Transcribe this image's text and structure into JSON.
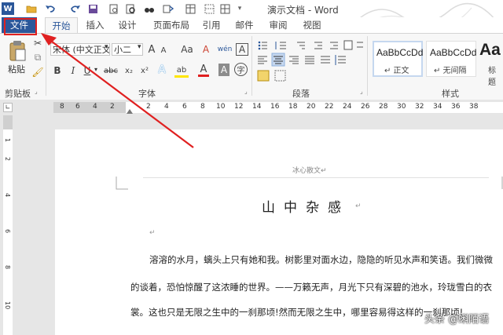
{
  "window": {
    "title": "演示文档 - Word",
    "qat_icons": [
      "word-logo-icon",
      "open-folder-icon",
      "undo-icon",
      "redo-icon",
      "save-icon",
      "print-preview-icon",
      "find-icon",
      "replace-icon",
      "format-painter-icon",
      "table-icon",
      "border-icon",
      "customize-icon"
    ]
  },
  "tabs": [
    "文件",
    "开始",
    "插入",
    "设计",
    "页面布局",
    "引用",
    "邮件",
    "审阅",
    "视图"
  ],
  "clipboard": {
    "paste_label": "粘贴",
    "group_label": "剪贴板"
  },
  "font": {
    "name_value": "宋体 (中文正文)",
    "size_value": "小二",
    "grow_label": "A",
    "shrink_label": "A",
    "case_label": "Aa",
    "clear_label": "A",
    "phonetic_label": "wén",
    "border_label": "A",
    "bold_label": "B",
    "italic_label": "I",
    "underline_label": "U",
    "strike_label": "abc",
    "sub_label": "x₂",
    "sup_label": "x²",
    "effects_label": "A",
    "highlight_label": "ab",
    "color_label": "A",
    "shade_label": "A",
    "enclose_label": "字",
    "group_label": "字体"
  },
  "paragraph": {
    "group_label": "段落"
  },
  "styles": {
    "group_label": "样式",
    "items": [
      {
        "sample": "AaBbCcDd",
        "name": "↵ 正文"
      },
      {
        "sample": "AaBbCcDd",
        "name": "↵ 无间隔"
      },
      {
        "sample": "Aa",
        "name": "标题"
      }
    ]
  },
  "ruler": {
    "left_numbers": [
      "8",
      "6",
      "4",
      "2"
    ],
    "numbers": [
      "2",
      "4",
      "6",
      "8",
      "10",
      "12",
      "14",
      "16",
      "18",
      "20",
      "22",
      "24",
      "26",
      "28",
      "30",
      "32",
      "34",
      "36",
      "38"
    ],
    "vertical_numbers": [
      "1",
      "2",
      "4",
      "6",
      "8",
      "10"
    ]
  },
  "document": {
    "header": "冰心散文↵",
    "title": "山中杂感",
    "title_mark": "↵",
    "empty_mark": "↵",
    "lines": [
      "溶溶的水月，螭头上只有她和我。树影里对面水边，隐隐的听见水声和笑语。我们微微",
      "的谈着，恐怕惊醒了这浓睡的世界。——万籁无声，月光下只有深碧的池水，玲珑雪白的衣",
      "裳。这也只是无限之生中的一刹那顷!然而无限之生中，哪里容易得这样的一刹那顷!"
    ]
  },
  "watermark": "头条 @蝌陌语",
  "accent": "#2b579a",
  "annotation_color": "#e02020"
}
